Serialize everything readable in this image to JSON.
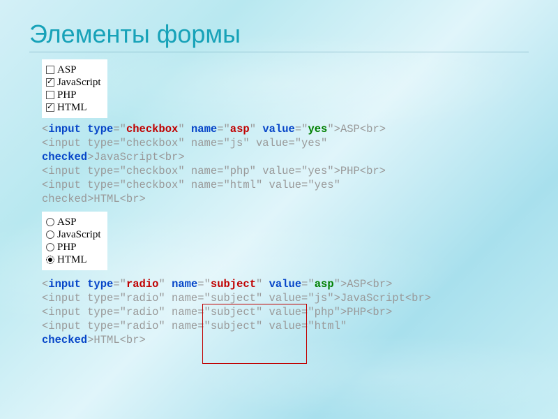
{
  "title": "Элементы формы",
  "checkbox_panel": {
    "items": [
      {
        "label": "ASP",
        "checked": false
      },
      {
        "label": "JavaScript",
        "checked": true
      },
      {
        "label": "PHP",
        "checked": false
      },
      {
        "label": "HTML",
        "checked": true
      }
    ]
  },
  "radio_panel": {
    "items": [
      {
        "label": "ASP",
        "checked": false
      },
      {
        "label": "JavaScript",
        "checked": false
      },
      {
        "label": "PHP",
        "checked": false
      },
      {
        "label": "HTML",
        "checked": true
      }
    ]
  },
  "code1": {
    "l1": {
      "a": "<",
      "b": "input type",
      "c": "=\"",
      "d": "checkbox",
      "e": "\" ",
      "f": "name",
      "g": "=\"",
      "h": "asp",
      "i": "\" ",
      "j": "value",
      "k": "=\"",
      "l": "yes",
      "m": "\">ASP<br>"
    },
    "l2": "<input type=\"checkbox\" name=\"js\" value=\"yes\"",
    "l3a": "checked",
    "l3b": ">JavaScript<br>",
    "l4": "<input type=\"checkbox\" name=\"php\" value=\"yes\">PHP<br>",
    "l5": "<input type=\"checkbox\" name=\"html\" value=\"yes\"",
    "l6": "checked>HTML<br>"
  },
  "code2": {
    "l1": {
      "a": "<",
      "b": "input type",
      "c": "=\"",
      "d": "radio",
      "e": "\" ",
      "f": "name",
      "g": "=\"",
      "h": "subject",
      "i": "\" ",
      "j": "value",
      "k": "=\"",
      "l": "asp",
      "m": "\">ASP<br>"
    },
    "l2": "<input type=\"radio\" name=\"subject\" value=\"js\">JavaScript<br>",
    "l3": "<input type=\"radio\" name=\"subject\" value=\"php\">PHP<br>",
    "l4": "<input type=\"radio\" name=\"subject\" value=\"html\"",
    "l5a": "checked",
    "l5b": ">HTML<br>"
  }
}
